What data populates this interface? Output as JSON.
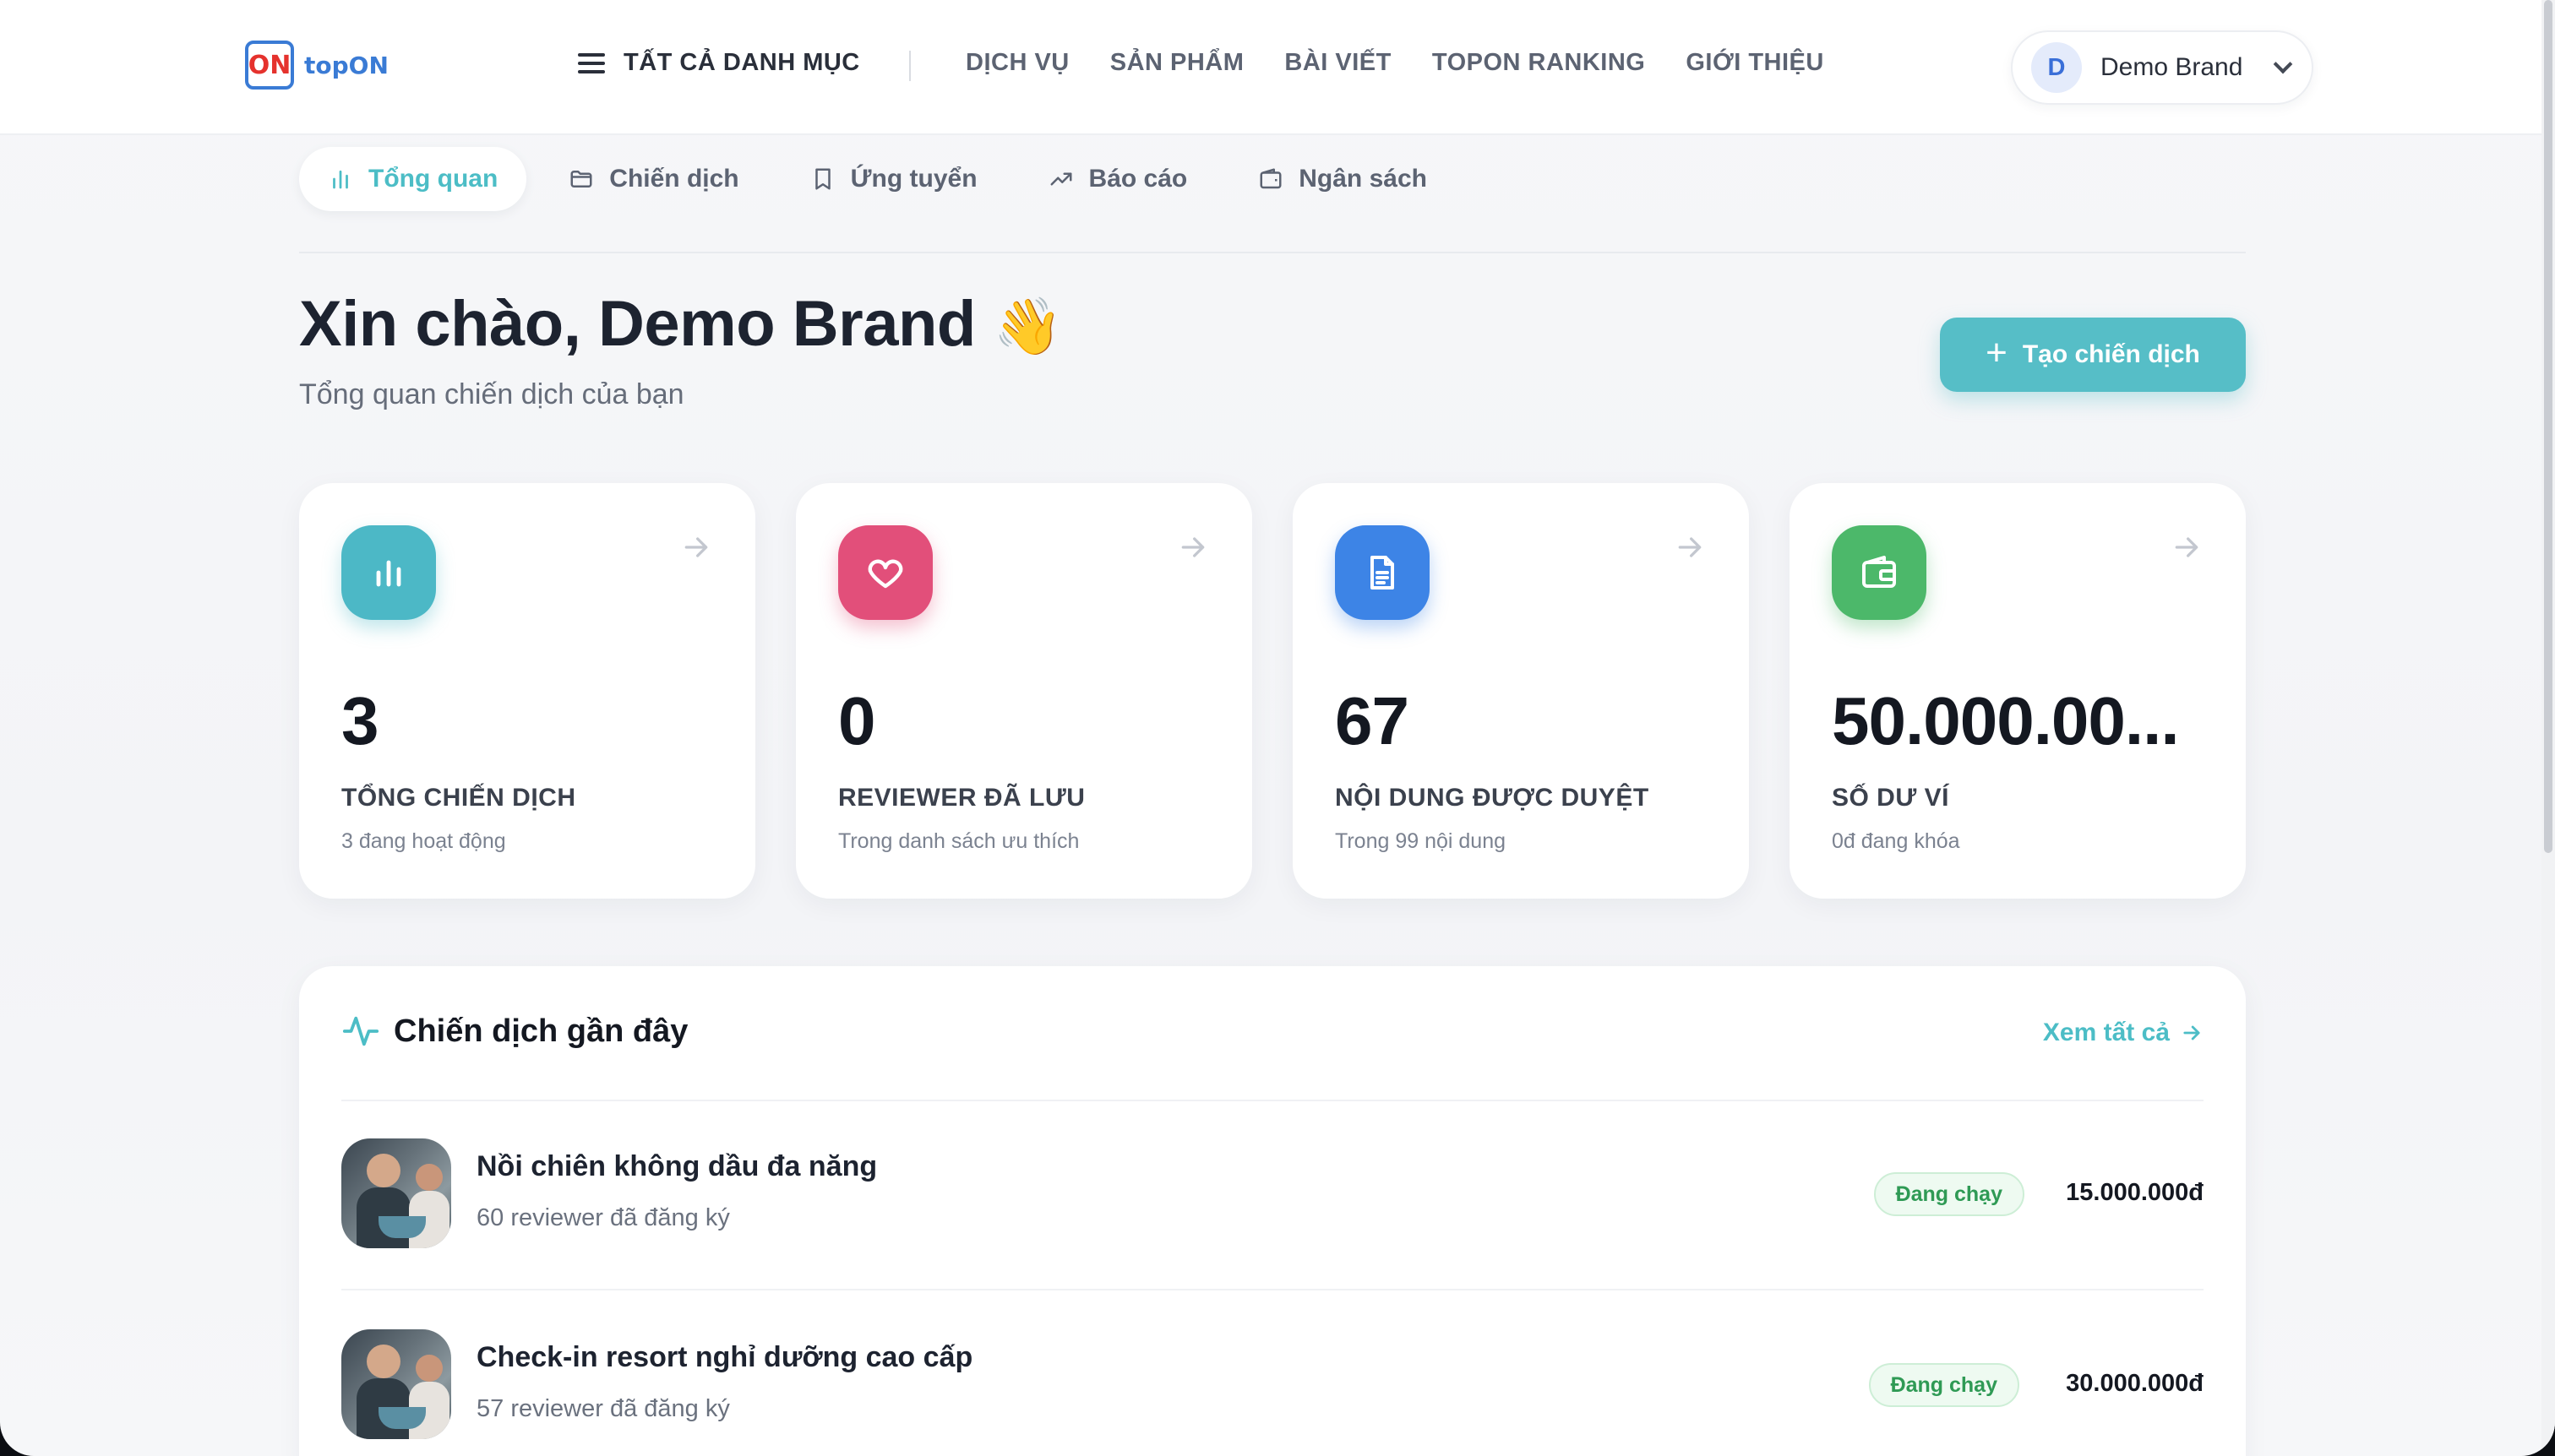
{
  "header": {
    "logo_text": "topON",
    "logo_mark": "ON",
    "all_categories": "TẤT CẢ DANH MỤC",
    "nav": [
      "DỊCH VỤ",
      "SẢN PHẨM",
      "BÀI VIẾT",
      "TOPON RANKING",
      "GIỚI THIỆU"
    ],
    "user": {
      "initial": "D",
      "name": "Demo Brand"
    }
  },
  "tabs": [
    {
      "label": "Tổng quan",
      "icon": "bar-chart-icon",
      "active": true
    },
    {
      "label": "Chiến dịch",
      "icon": "folder-icon",
      "active": false
    },
    {
      "label": "Ứng tuyển",
      "icon": "bookmark-icon",
      "active": false
    },
    {
      "label": "Báo cáo",
      "icon": "trend-up-icon",
      "active": false
    },
    {
      "label": "Ngân sách",
      "icon": "wallet-icon",
      "active": false
    }
  ],
  "greeting": {
    "title": "Xin chào, Demo Brand",
    "emoji": "👋",
    "subtitle": "Tổng quan chiến dịch của bạn",
    "create_button": "Tạo chiến dịch"
  },
  "stats": [
    {
      "value": "3",
      "label": "TỔNG CHIẾN DỊCH",
      "sub": "3 đang hoạt động",
      "icon": "bar-chart-icon",
      "color": "#4cb8c6"
    },
    {
      "value": "0",
      "label": "REVIEWER ĐÃ LƯU",
      "sub": "Trong danh sách ưu thích",
      "icon": "heart-icon",
      "color": "#e24f7a"
    },
    {
      "value": "67",
      "label": "NỘI DUNG ĐƯỢC DUYỆT",
      "sub": "Trong 99 nội dung",
      "icon": "document-icon",
      "color": "#3d84e6"
    },
    {
      "value": "50.000.00...",
      "label": "SỐ DƯ VÍ",
      "sub": "0đ đang khóa",
      "icon": "wallet-icon",
      "color": "#4cb86a"
    }
  ],
  "recent": {
    "title": "Chiến dịch gần đây",
    "see_all": "Xem tất cả",
    "items": [
      {
        "name": "Nồi chiên không dầu đa năng",
        "registered": "60 reviewer đã đăng ký",
        "status": "Đang chạy",
        "amount": "15.000.000đ"
      },
      {
        "name": "Check-in resort nghỉ dưỡng cao cấp",
        "registered": "57 reviewer đã đăng ký",
        "status": "Đang chạy",
        "amount": "30.000.000đ"
      }
    ]
  },
  "colors": {
    "accent": "#4cbdc6",
    "status_green": "#2f9a55"
  }
}
